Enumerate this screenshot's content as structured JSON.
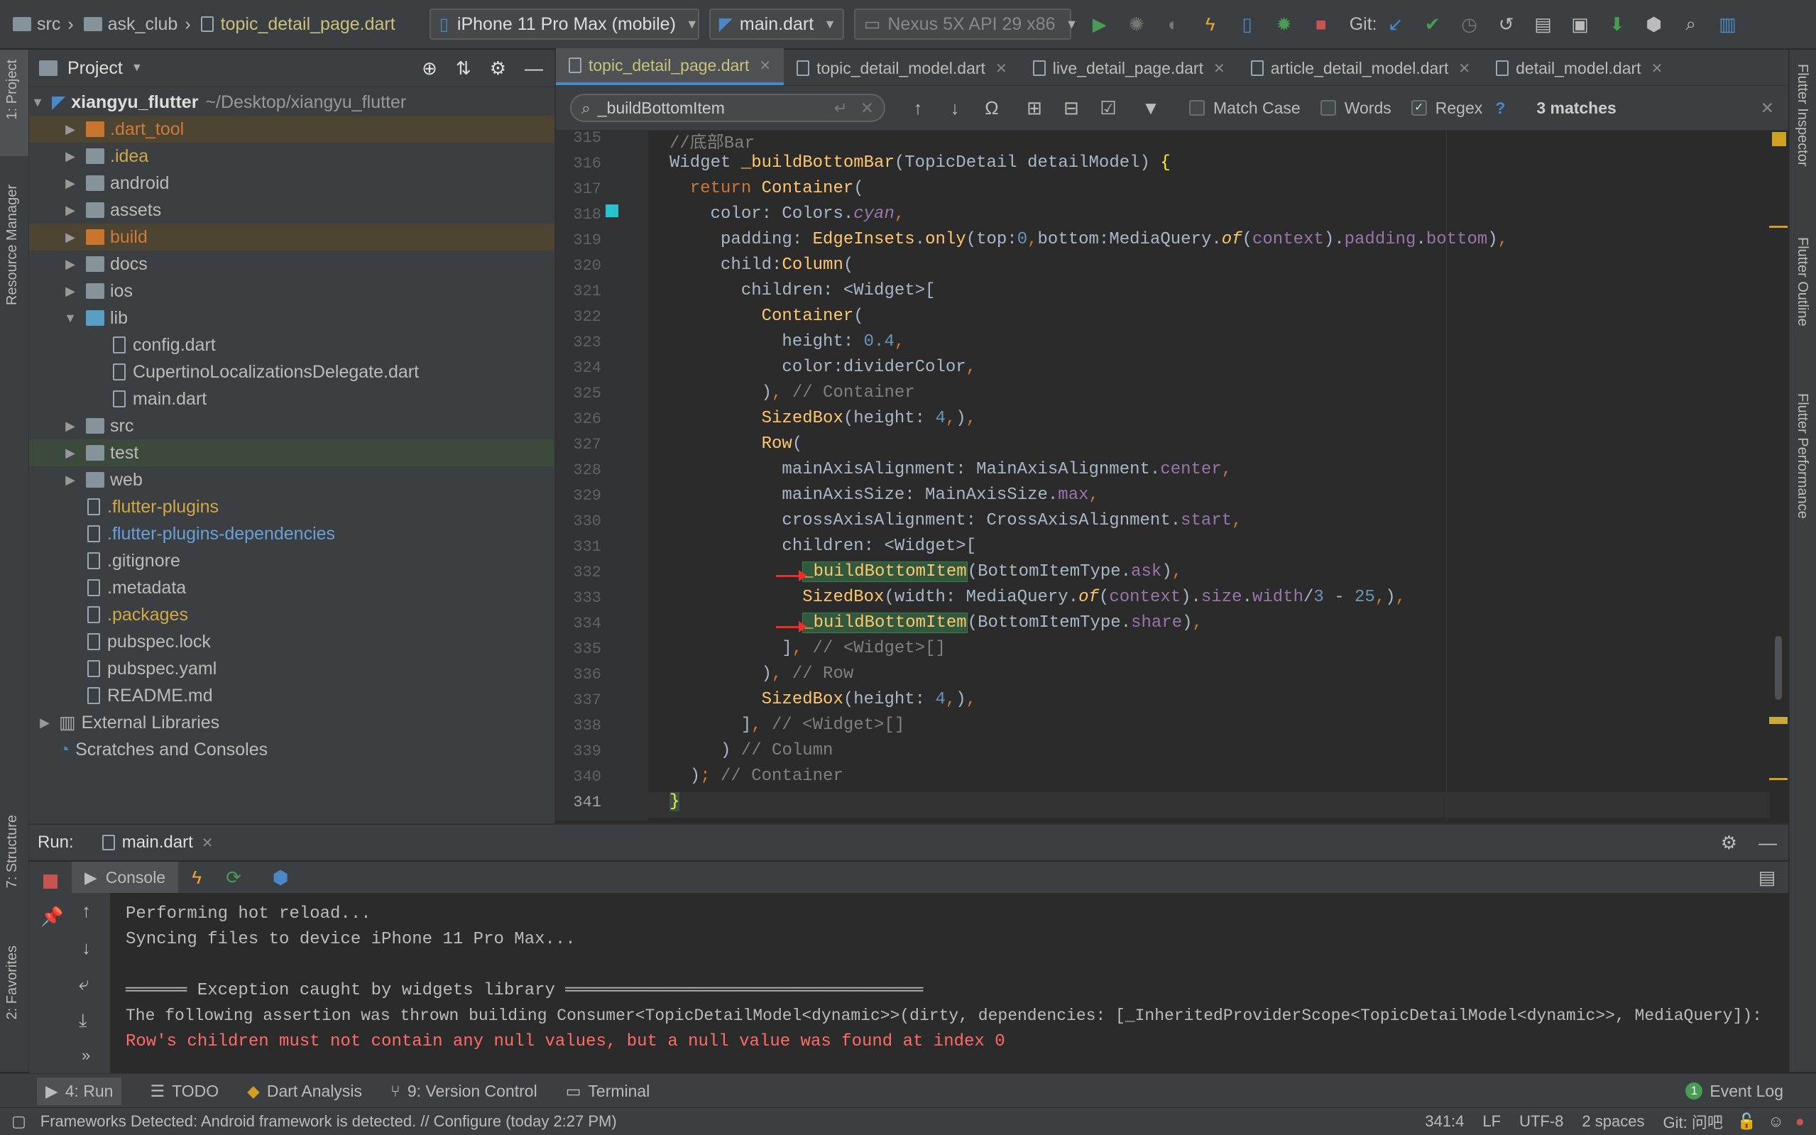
{
  "breadcrumb": [
    "src",
    "ask_club",
    "topic_detail_page.dart"
  ],
  "device_selector": "iPhone 11 Pro Max (mobile)",
  "run_config": "main.dart",
  "emulator_selector": "Nexus 5X API 29 x86",
  "git_label": "Git:",
  "left_stripe": {
    "project": "1: Project",
    "resource_manager": "Resource Manager",
    "structure": "7: Structure",
    "favorites": "2: Favorites"
  },
  "right_stripe": {
    "inspector": "Flutter Inspector",
    "outline": "Flutter Outline",
    "performance": "Flutter Performance"
  },
  "project_panel": {
    "title": "Project",
    "root_name": "xiangyu_flutter",
    "root_path": "~/Desktop/xiangyu_flutter",
    "items": [
      {
        "label": ".dart_tool",
        "type": "folder",
        "color": "#d07a3a"
      },
      {
        "label": ".idea",
        "type": "folder",
        "color": "#d0a84a"
      },
      {
        "label": "android",
        "type": "folder"
      },
      {
        "label": "assets",
        "type": "folder"
      },
      {
        "label": "build",
        "type": "folder",
        "color": "#d07a3a"
      },
      {
        "label": "docs",
        "type": "folder"
      },
      {
        "label": "ios",
        "type": "folder"
      },
      {
        "label": "lib",
        "type": "folder"
      },
      {
        "label": "config.dart",
        "type": "file"
      },
      {
        "label": "CupertinoLocalizationsDelegate.dart",
        "type": "file"
      },
      {
        "label": "main.dart",
        "type": "file"
      },
      {
        "label": "src",
        "type": "folder"
      },
      {
        "label": "test",
        "type": "folder"
      },
      {
        "label": "web",
        "type": "folder"
      },
      {
        "label": ".flutter-plugins",
        "type": "file",
        "color": "#d0a84a"
      },
      {
        "label": ".flutter-plugins-dependencies",
        "type": "file",
        "color": "#6a9fd8"
      },
      {
        "label": ".gitignore",
        "type": "file"
      },
      {
        "label": ".metadata",
        "type": "file"
      },
      {
        "label": ".packages",
        "type": "file",
        "color": "#d0a84a"
      },
      {
        "label": "pubspec.lock",
        "type": "file"
      },
      {
        "label": "pubspec.yaml",
        "type": "file"
      },
      {
        "label": "README.md",
        "type": "file"
      },
      {
        "label": "External Libraries",
        "type": "lib"
      },
      {
        "label": "Scratches and Consoles",
        "type": "scratch"
      }
    ]
  },
  "editor_tabs": [
    "topic_detail_page.dart",
    "topic_detail_model.dart",
    "live_detail_page.dart",
    "article_detail_model.dart",
    "detail_model.dart"
  ],
  "find_bar": {
    "query": "_buildBottomItem",
    "match_case": "Match Case",
    "words": "Words",
    "regex": "Regex",
    "help": "?",
    "matches": "3 matches"
  },
  "line_numbers": [
    "315",
    "316",
    "317",
    "318",
    "319",
    "320",
    "321",
    "322",
    "323",
    "324",
    "325",
    "326",
    "327",
    "328",
    "329",
    "330",
    "331",
    "332",
    "333",
    "334",
    "335",
    "336",
    "337",
    "338",
    "339",
    "340",
    "341"
  ],
  "run_panel": {
    "title": "Run:",
    "tab": "main.dart",
    "console_tab": "Console",
    "output": [
      "Performing hot reload...",
      "Syncing files to device iPhone 11 Pro Max...",
      "",
      "══════ Exception caught by widgets library ═══════════════════════════════════",
      "The following assertion was thrown building Consumer<TopicDetailModel<dynamic>>(dirty, dependencies: [_InheritedProviderScope<TopicDetailModel<dynamic>>, MediaQuery]):",
      "Row's children must not contain any null values, but a null value was found at index 0"
    ]
  },
  "bottom_tools": {
    "run": "4: Run",
    "todo": "TODO",
    "dart_analysis": "Dart Analysis",
    "vcs": "9: Version Control",
    "terminal": "Terminal",
    "event_log": "Event Log",
    "event_count": "1"
  },
  "status": {
    "message": "Frameworks Detected: Android framework is detected. // Configure (today 2:27 PM)",
    "position": "341:4",
    "line_sep": "LF",
    "encoding": "UTF-8",
    "indent": "2 spaces",
    "git": "Git: 问吧"
  },
  "colors": {
    "accent": "#4a88c7",
    "error": "#ff6b68",
    "run_green": "#499c54",
    "stop_red": "#c75450"
  }
}
